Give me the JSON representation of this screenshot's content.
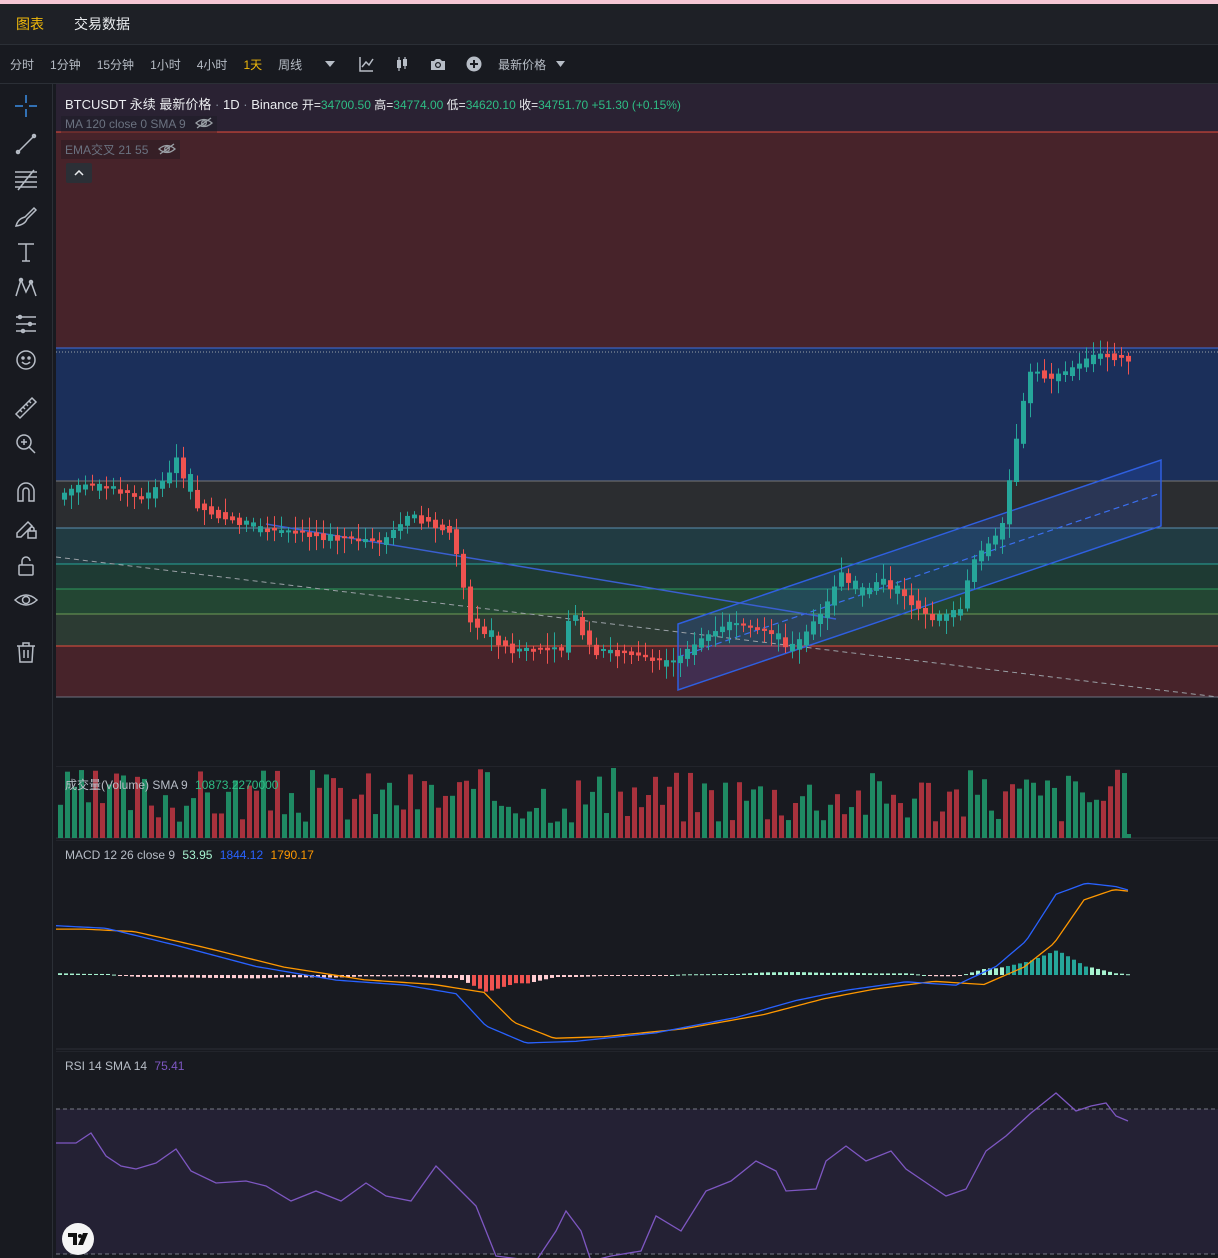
{
  "tabs": [
    {
      "label": "图表",
      "active": true
    },
    {
      "label": "交易数据",
      "active": false
    }
  ],
  "toolbar": {
    "intervals": [
      {
        "label": "分时",
        "active": false
      },
      {
        "label": "1分钟",
        "active": false
      },
      {
        "label": "15分钟",
        "active": false
      },
      {
        "label": "1小时",
        "active": false
      },
      {
        "label": "4小时",
        "active": false
      },
      {
        "label": "1天",
        "active": true
      },
      {
        "label": "周线",
        "active": false
      }
    ],
    "price_menu": "最新价格"
  },
  "sidebar_icons": [
    "crosshair-icon",
    "trend-line-icon",
    "fib-retracement-icon",
    "brush-icon",
    "text-icon",
    "pattern-icon",
    "forecast-icon",
    "emoji-icon",
    "ruler-icon",
    "zoom-in-icon",
    "magnet-icon",
    "lock-drawing-icon",
    "lock-icon",
    "eye-icon",
    "trash-icon"
  ],
  "legend": {
    "symbol": "BTCUSDT 永续",
    "price_type": "最新价格",
    "interval": "1D",
    "exchange": "Binance",
    "open_label": "开=",
    "open": "34700.50",
    "high_label": "高=",
    "high": "34774.00",
    "low_label": "低=",
    "low": "34620.10",
    "close_label": "收=",
    "close": "34751.70",
    "change": "+51.30",
    "change_pct": "(+0.15%)",
    "ma_label": "MA 120 close 0 SMA 9",
    "ema_label": "EMA交叉 21 55"
  },
  "volume_pane": {
    "label": "成交量(Volume) SMA 9",
    "value": "10873.2270000"
  },
  "macd_pane": {
    "label": "MACD 12 26 close 9",
    "hist": "53.95",
    "macd": "1844.12",
    "signal": "1790.17"
  },
  "rsi_pane": {
    "label": "RSI 14 SMA 14",
    "value": "75.41"
  },
  "colors": {
    "up": "#26a69a",
    "down": "#ef5350",
    "accent": "#f0b90b",
    "macd_line": "#2962ff",
    "signal_line": "#ff9800",
    "rsi": "#7e57c2"
  },
  "chart_data": {
    "type": "candlestick",
    "symbol": "BTCUSDT 永续",
    "interval": "1D",
    "last_close": 34751.7,
    "indicators": [
      "成交量(Volume) SMA 9",
      "MACD 12 26 close 9",
      "RSI 14 SMA 14"
    ]
  }
}
